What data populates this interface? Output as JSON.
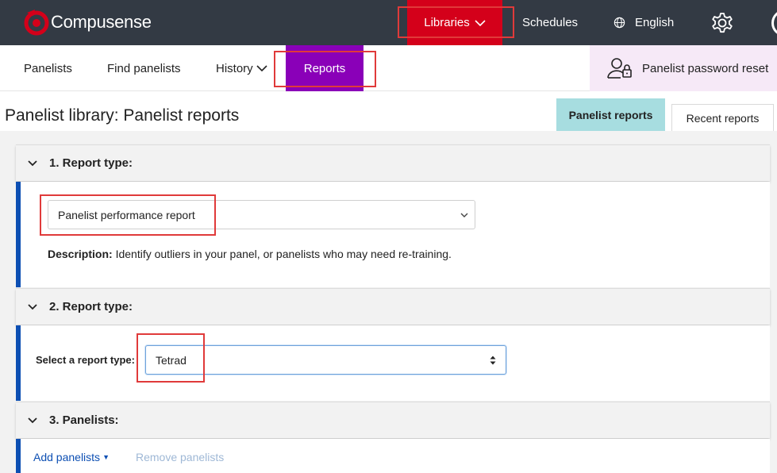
{
  "app": {
    "brand": "Compusense",
    "brand_color": "#d4001a"
  },
  "topnav": {
    "libraries_label": "Libraries",
    "schedules_label": "Schedules",
    "language_label": "English"
  },
  "subnav": {
    "panelists_label": "Panelists",
    "find_label": "Find panelists",
    "history_label": "History",
    "reports_label": "Reports",
    "password_reset_label": "Panelist password reset"
  },
  "page": {
    "title": "Panelist library: Panelist reports",
    "tabs": [
      {
        "label": "Panelist reports",
        "active": true
      },
      {
        "label": "Recent reports",
        "active": false
      }
    ]
  },
  "sections": [
    {
      "heading": "1. Report type:",
      "select_value": "Panelist performance report",
      "description_label": "Description:",
      "description_text": " Identify outliers in your panel, or panelists who may need re-training."
    },
    {
      "heading": "2. Report type:",
      "select_label": "Select a report type:",
      "select_value": "Tetrad"
    },
    {
      "heading": "3. Panelists:",
      "add_label": "Add panelists",
      "remove_label": "Remove panelists"
    }
  ],
  "icons": [
    "logo-mark",
    "chevron-down-icon",
    "globe-icon",
    "gear-icon",
    "user-lock-icon",
    "select-caret-icon",
    "updown-caret-icon"
  ],
  "colors": {
    "topbar": "#333a44",
    "libraries_active": "#d4001a",
    "reports_active": "#8a00b8",
    "password_reset_bg": "#f6e9f7",
    "tab_active": "#a7dde0",
    "section_accent": "#0d4fb3",
    "highlight": "#e03a3a"
  }
}
